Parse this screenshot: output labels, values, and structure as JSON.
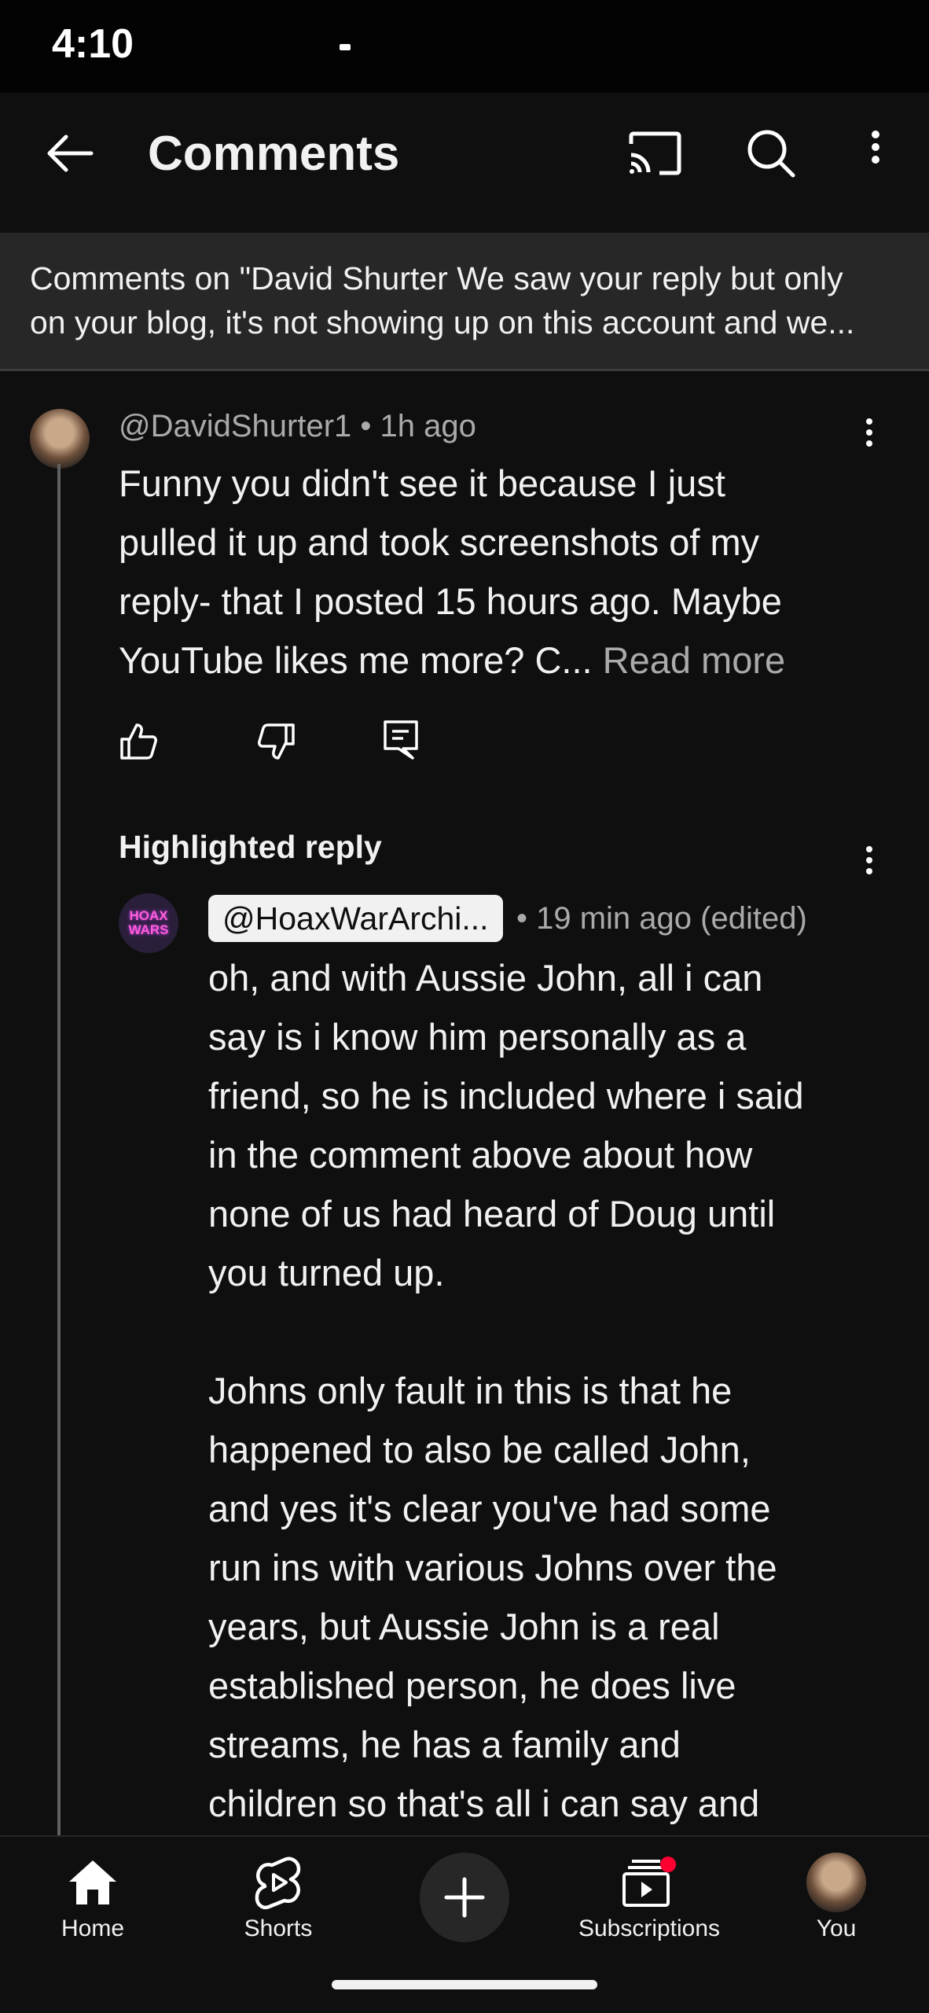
{
  "status_bar": {
    "time": "4:10"
  },
  "app_bar": {
    "title": "Comments",
    "icons": [
      "back-arrow-icon",
      "cast-icon",
      "search-icon",
      "more-vert-icon"
    ]
  },
  "banner": {
    "line1": "Comments on \"David Shurter We saw your reply but only",
    "line2": "on your blog, it's not showing up on this account and we..."
  },
  "comment": {
    "author": "@DavidShurter1",
    "time": "1h ago",
    "text_lines": [
      "Funny you didn't see it because I just",
      "pulled it up and took screenshots of my",
      "reply- that I posted 15 hours ago. Maybe"
    ],
    "last_line": "YouTube likes me more? C...",
    "read_more": "Read more",
    "actions": [
      "like-icon",
      "dislike-icon",
      "reply-icon"
    ]
  },
  "highlighted_reply": {
    "label": "Highlighted reply",
    "author": "@HoaxWarArchi...",
    "time": "• 19 min ago (edited)",
    "avatar_text": "HOAX WARS",
    "paragraph1": [
      "oh, and with Aussie John, all i can",
      "say is i know him personally as a",
      "friend, so he is included where i said",
      "in the comment above about how",
      "none of us had heard of Doug until",
      "you turned up."
    ],
    "paragraph2": [
      "Johns only fault in this is that he",
      "happened to also be called John,",
      "and yes it's clear you've had some",
      "run ins with various Johns over the",
      "years, but Aussie John is a real",
      "established person, he does live",
      "streams, he has a family and",
      "children so that's all i can say and"
    ]
  },
  "bottom_nav": {
    "home": "Home",
    "shorts": "Shorts",
    "subscriptions": "Subscriptions",
    "you": "You"
  },
  "colors": {
    "background": "#0f0f0f",
    "banner": "#272727",
    "secondary_text": "#aaaaaa",
    "notification_dot": "#ff0033"
  }
}
